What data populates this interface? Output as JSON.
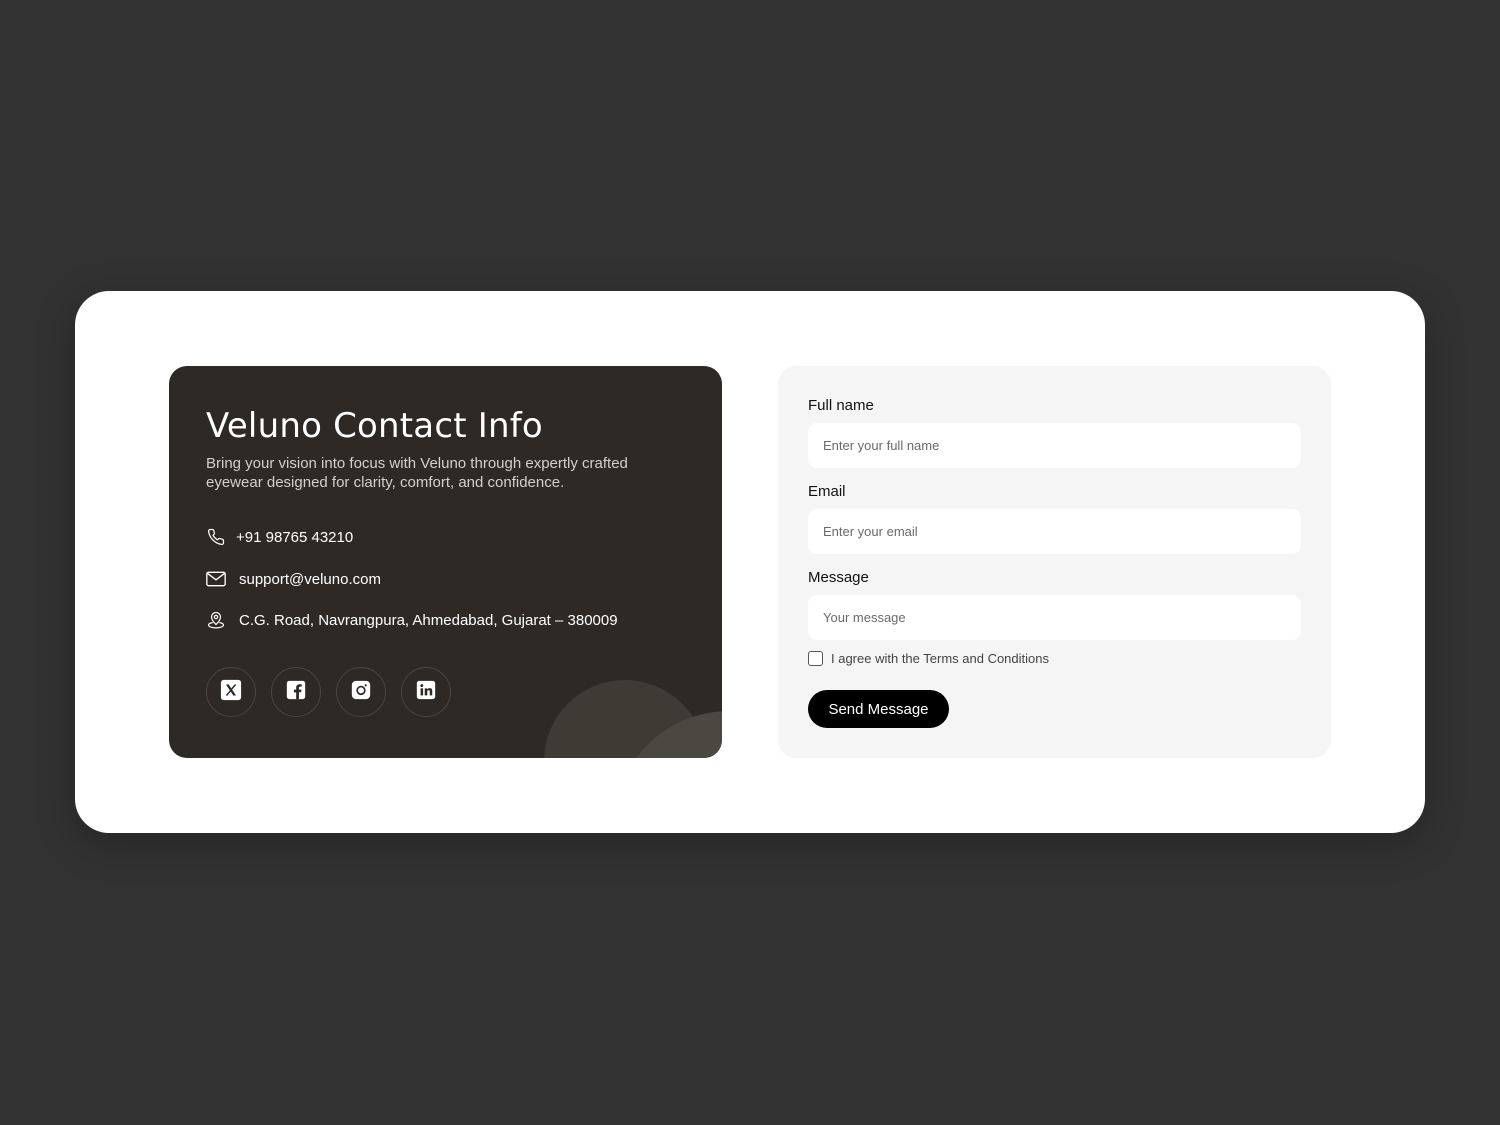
{
  "info": {
    "title": "Veluno Contact Info",
    "description": "Bring your vision into focus with Veluno through expertly crafted eyewear designed for clarity, comfort, and confidence.",
    "phone": "+91 98765 43210",
    "email": "support@veluno.com",
    "address": "C.G. Road, Navrangpura, Ahmedabad, Gujarat – 380009",
    "socials": [
      {
        "icon": "x-icon"
      },
      {
        "icon": "facebook-icon"
      },
      {
        "icon": "instagram-icon"
      },
      {
        "icon": "linkedin-icon"
      }
    ]
  },
  "form": {
    "name_label": "Full name",
    "name_placeholder": "Enter your full name",
    "email_label": "Email",
    "email_placeholder": "Enter your email",
    "message_label": "Message",
    "message_placeholder": "Your message",
    "terms_label": "I agree with the Terms and Conditions",
    "terms_checked": false,
    "submit_label": "Send Message"
  },
  "colors": {
    "page_background": "#323232",
    "card_background": "#ffffff",
    "info_panel": "#2e2925",
    "form_panel": "#f5f5f5",
    "button": "#000000"
  }
}
